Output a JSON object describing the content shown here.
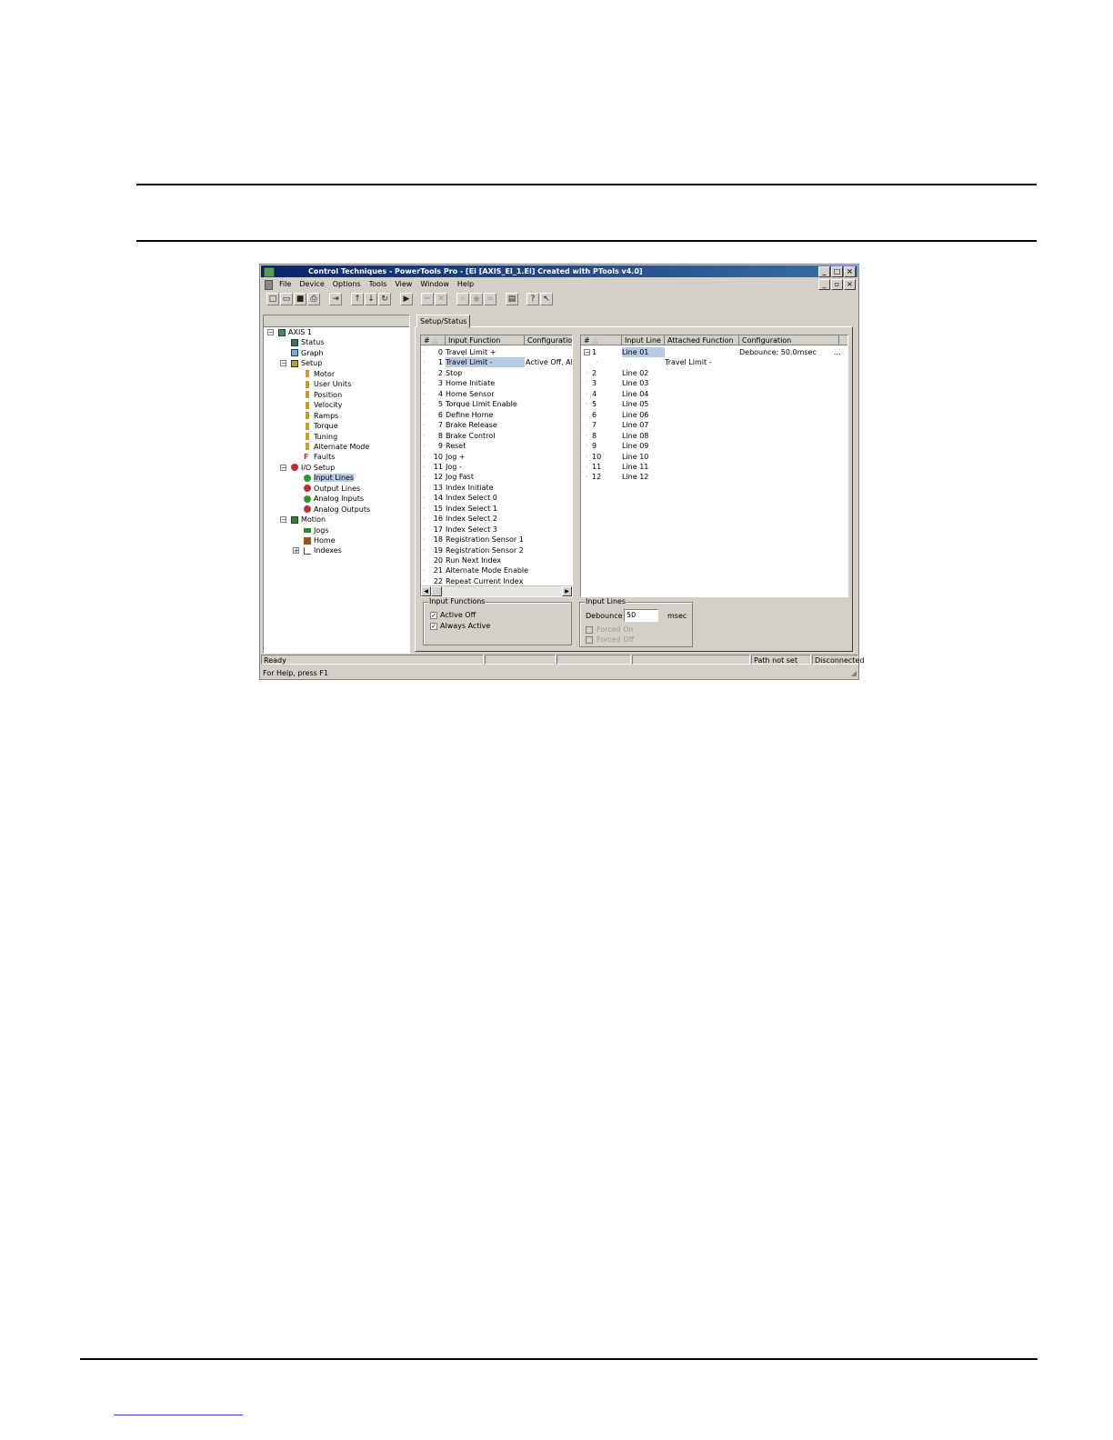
{
  "window": {
    "title": "Control Techniques - PowerTools Pro - [Ei  [AXIS_EI_1.Ei] Created with PTools v4.0]",
    "caption_buttons": [
      "_",
      "□",
      "×"
    ],
    "mdi_buttons": [
      "_",
      "▫",
      "×"
    ]
  },
  "menu": [
    "File",
    "Device",
    "Options",
    "Tools",
    "View",
    "Window",
    "Help"
  ],
  "tree": [
    {
      "label": "AXIS 1",
      "expander": "−"
    },
    {
      "label": "Status"
    },
    {
      "label": "Graph"
    },
    {
      "label": "Setup",
      "expander": "−"
    },
    {
      "label": "Motor"
    },
    {
      "label": "User Units"
    },
    {
      "label": "Position"
    },
    {
      "label": "Velocity"
    },
    {
      "label": "Ramps"
    },
    {
      "label": "Torque"
    },
    {
      "label": "Tuning"
    },
    {
      "label": "Alternate Mode"
    },
    {
      "label": "Faults"
    },
    {
      "label": "I/O Setup",
      "expander": "−"
    },
    {
      "label": "Input Lines"
    },
    {
      "label": "Output Lines"
    },
    {
      "label": "Analog Inputs"
    },
    {
      "label": "Analog Outputs"
    },
    {
      "label": "Motion",
      "expander": "−"
    },
    {
      "label": "Jogs"
    },
    {
      "label": "Home"
    },
    {
      "label": "Indexes",
      "expander": "+"
    }
  ],
  "tab": "Setup/Status",
  "input_functions_table": {
    "headers": [
      "#",
      "Input Function",
      "Configuration"
    ],
    "rows": [
      {
        "num": "0",
        "name": "Travel Limit +",
        "config": ""
      },
      {
        "num": "1",
        "name": "Travel Limit -",
        "config": "Active Off, Al..."
      },
      {
        "num": "2",
        "name": "Stop",
        "config": ""
      },
      {
        "num": "3",
        "name": "Home Initiate",
        "config": ""
      },
      {
        "num": "4",
        "name": "Home Sensor",
        "config": ""
      },
      {
        "num": "5",
        "name": "Torque Limit Enable",
        "config": ""
      },
      {
        "num": "6",
        "name": "Define Home",
        "config": ""
      },
      {
        "num": "7",
        "name": "Brake Release",
        "config": ""
      },
      {
        "num": "8",
        "name": "Brake Control",
        "config": ""
      },
      {
        "num": "9",
        "name": "Reset",
        "config": ""
      },
      {
        "num": "10",
        "name": "Jog +",
        "config": ""
      },
      {
        "num": "11",
        "name": "Jog -",
        "config": ""
      },
      {
        "num": "12",
        "name": "Jog Fast",
        "config": ""
      },
      {
        "num": "13",
        "name": "Index Initiate",
        "config": ""
      },
      {
        "num": "14",
        "name": "Index Select 0",
        "config": ""
      },
      {
        "num": "15",
        "name": "Index Select 1",
        "config": ""
      },
      {
        "num": "16",
        "name": "Index Select 2",
        "config": ""
      },
      {
        "num": "17",
        "name": "Index Select 3",
        "config": ""
      },
      {
        "num": "18",
        "name": "Registration Sensor 1",
        "config": ""
      },
      {
        "num": "19",
        "name": "Registration Sensor 2",
        "config": ""
      },
      {
        "num": "20",
        "name": "Run Next Index",
        "config": ""
      },
      {
        "num": "21",
        "name": "Alternate Mode Enable",
        "config": ""
      },
      {
        "num": "22",
        "name": "Repeat Current Index",
        "config": ""
      }
    ]
  },
  "input_lines_table": {
    "headers": [
      "#",
      "Input Line",
      "Attached Function",
      "Configuration"
    ],
    "rows": [
      {
        "num": "1",
        "line": "Line 01",
        "func": "",
        "config": "Debounce: 50.0msec",
        "extra": "..."
      },
      {
        "num": "",
        "line": "",
        "func": "Travel Limit -",
        "config": "",
        "extra": ""
      },
      {
        "num": "2",
        "line": "Line 02",
        "func": "",
        "config": "",
        "extra": ""
      },
      {
        "num": "3",
        "line": "Line 03",
        "func": "",
        "config": "",
        "extra": ""
      },
      {
        "num": "4",
        "line": "Line 04",
        "func": "",
        "config": "",
        "extra": ""
      },
      {
        "num": "5",
        "line": "Line 05",
        "func": "",
        "config": "",
        "extra": ""
      },
      {
        "num": "6",
        "line": "Line 06",
        "func": "",
        "config": "",
        "extra": ""
      },
      {
        "num": "7",
        "line": "Line 07",
        "func": "",
        "config": "",
        "extra": ""
      },
      {
        "num": "8",
        "line": "Line 08",
        "func": "",
        "config": "",
        "extra": ""
      },
      {
        "num": "9",
        "line": "Line 09",
        "func": "",
        "config": "",
        "extra": ""
      },
      {
        "num": "10",
        "line": "Line 10",
        "func": "",
        "config": "",
        "extra": ""
      },
      {
        "num": "11",
        "line": "Line 11",
        "func": "",
        "config": "",
        "extra": ""
      },
      {
        "num": "12",
        "line": "Line 12",
        "func": "",
        "config": "",
        "extra": ""
      }
    ]
  },
  "input_functions_group": {
    "label": "Input Functions",
    "active_off": "Active Off",
    "always_active": "Always Active"
  },
  "input_lines_group": {
    "label": "Input Lines",
    "debounce_label": "Debounce",
    "debounce_value": "50",
    "unit": "msec",
    "forced_on": "Forced On",
    "forced_off": "Forced Off"
  },
  "status": {
    "ready": "Ready",
    "path": "Path not set",
    "connection": "Disconnected",
    "help": "For Help, press F1"
  },
  "colors": {
    "title_start": "#0a246a",
    "title_end": "#3a6ea5",
    "selection": "#b7cbe8",
    "face": "#d4d0c8"
  }
}
